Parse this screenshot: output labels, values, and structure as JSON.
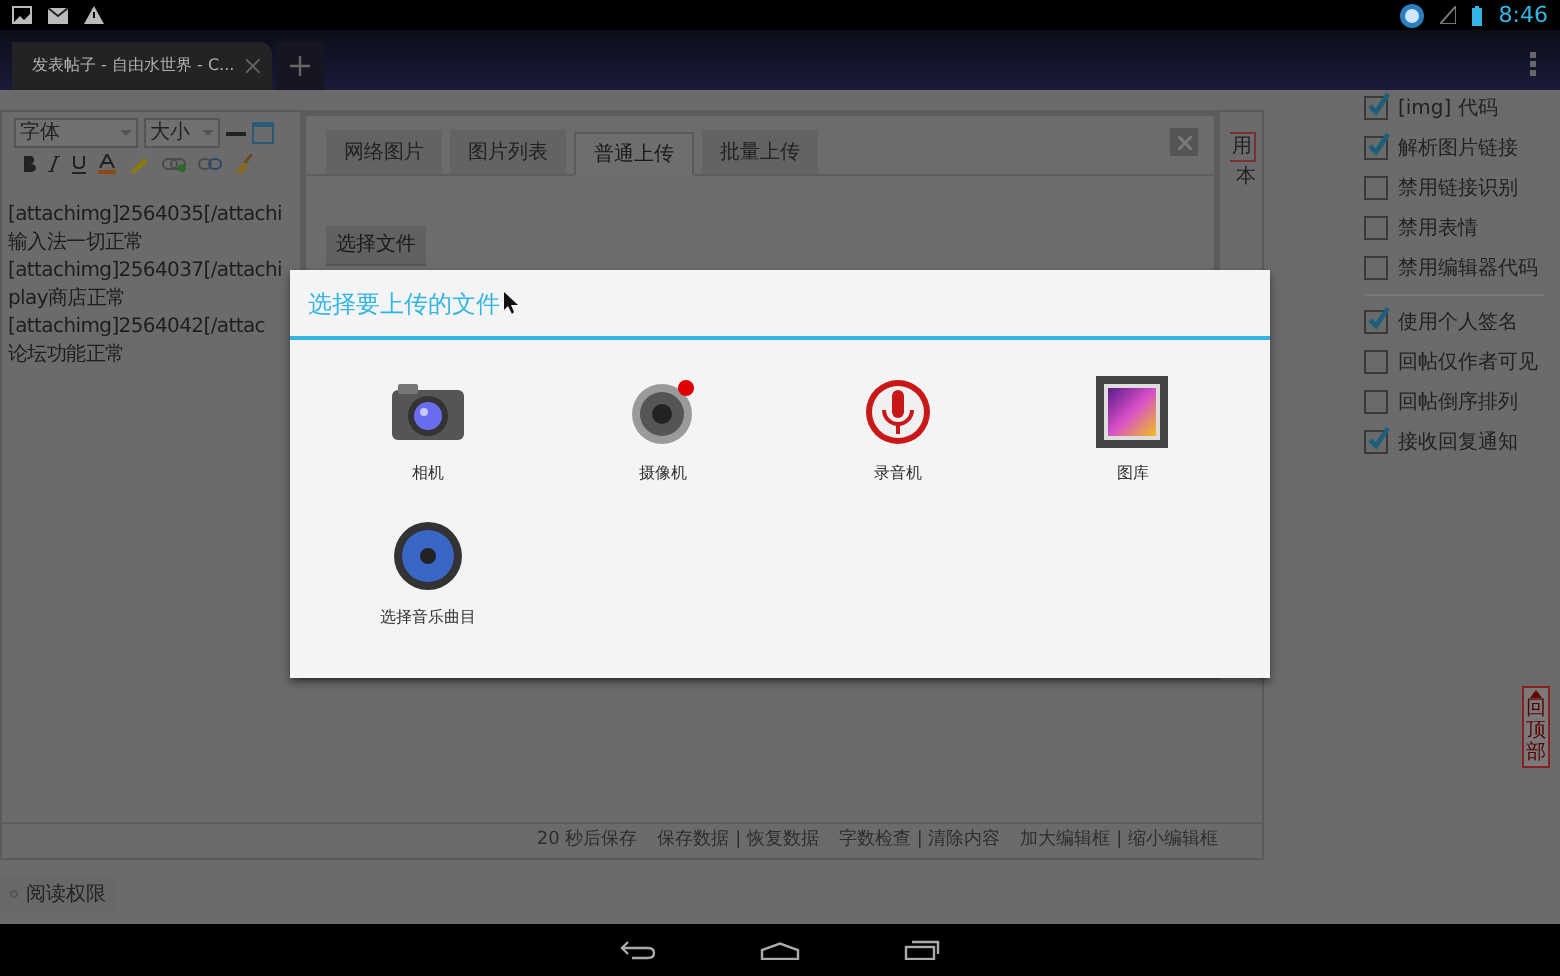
{
  "status_bar": {
    "time": "8:46"
  },
  "browser": {
    "tab": {
      "title": "发表帖子 - 自由水世界 - C..."
    }
  },
  "editor": {
    "font_select": "字体",
    "size_select": "大小",
    "lines": [
      "[attachimg]2564035[/attachi",
      "输入法一切正常",
      "[attachimg]2564037[/attachi",
      "play商店正常",
      "[attachimg]2564042[/attac",
      "论坛功能正常"
    ],
    "side_labels": [
      "用",
      "本"
    ],
    "footer": [
      "20 秒后保存",
      "保存数据 | 恢复数据",
      "字数检查 | 清除内容",
      "加大编辑框 | 缩小编辑框"
    ]
  },
  "read_permission": "阅读权限",
  "option_groups": [
    [
      {
        "label": "[img] 代码",
        "checked": true
      },
      {
        "label": "解析图片链接",
        "checked": true
      },
      {
        "label": "禁用链接识别",
        "checked": false
      },
      {
        "label": "禁用表情",
        "checked": false
      },
      {
        "label": "禁用编辑器代码",
        "checked": false
      }
    ],
    [
      {
        "label": "使用个人签名",
        "checked": true
      },
      {
        "label": "回帖仅作者可见",
        "checked": false
      },
      {
        "label": "回帖倒序排列",
        "checked": false
      },
      {
        "label": "接收回复通知",
        "checked": true
      }
    ]
  ],
  "back_to_top": "回顶部",
  "upload_panel": {
    "tabs": [
      {
        "label": "网络图片",
        "selected": false
      },
      {
        "label": "图片列表",
        "selected": false
      },
      {
        "label": "普通上传",
        "selected": true
      },
      {
        "label": "批量上传",
        "selected": false
      }
    ],
    "choose_file_button": "选择文件"
  },
  "file_dialog": {
    "title": "选择要上传的文件",
    "apps": [
      {
        "label": "相机",
        "kind": "camera"
      },
      {
        "label": "摄像机",
        "kind": "camcorder"
      },
      {
        "label": "录音机",
        "kind": "recorder"
      },
      {
        "label": "图库",
        "kind": "gallery"
      },
      {
        "label": "选择音乐曲目",
        "kind": "music"
      }
    ]
  }
}
